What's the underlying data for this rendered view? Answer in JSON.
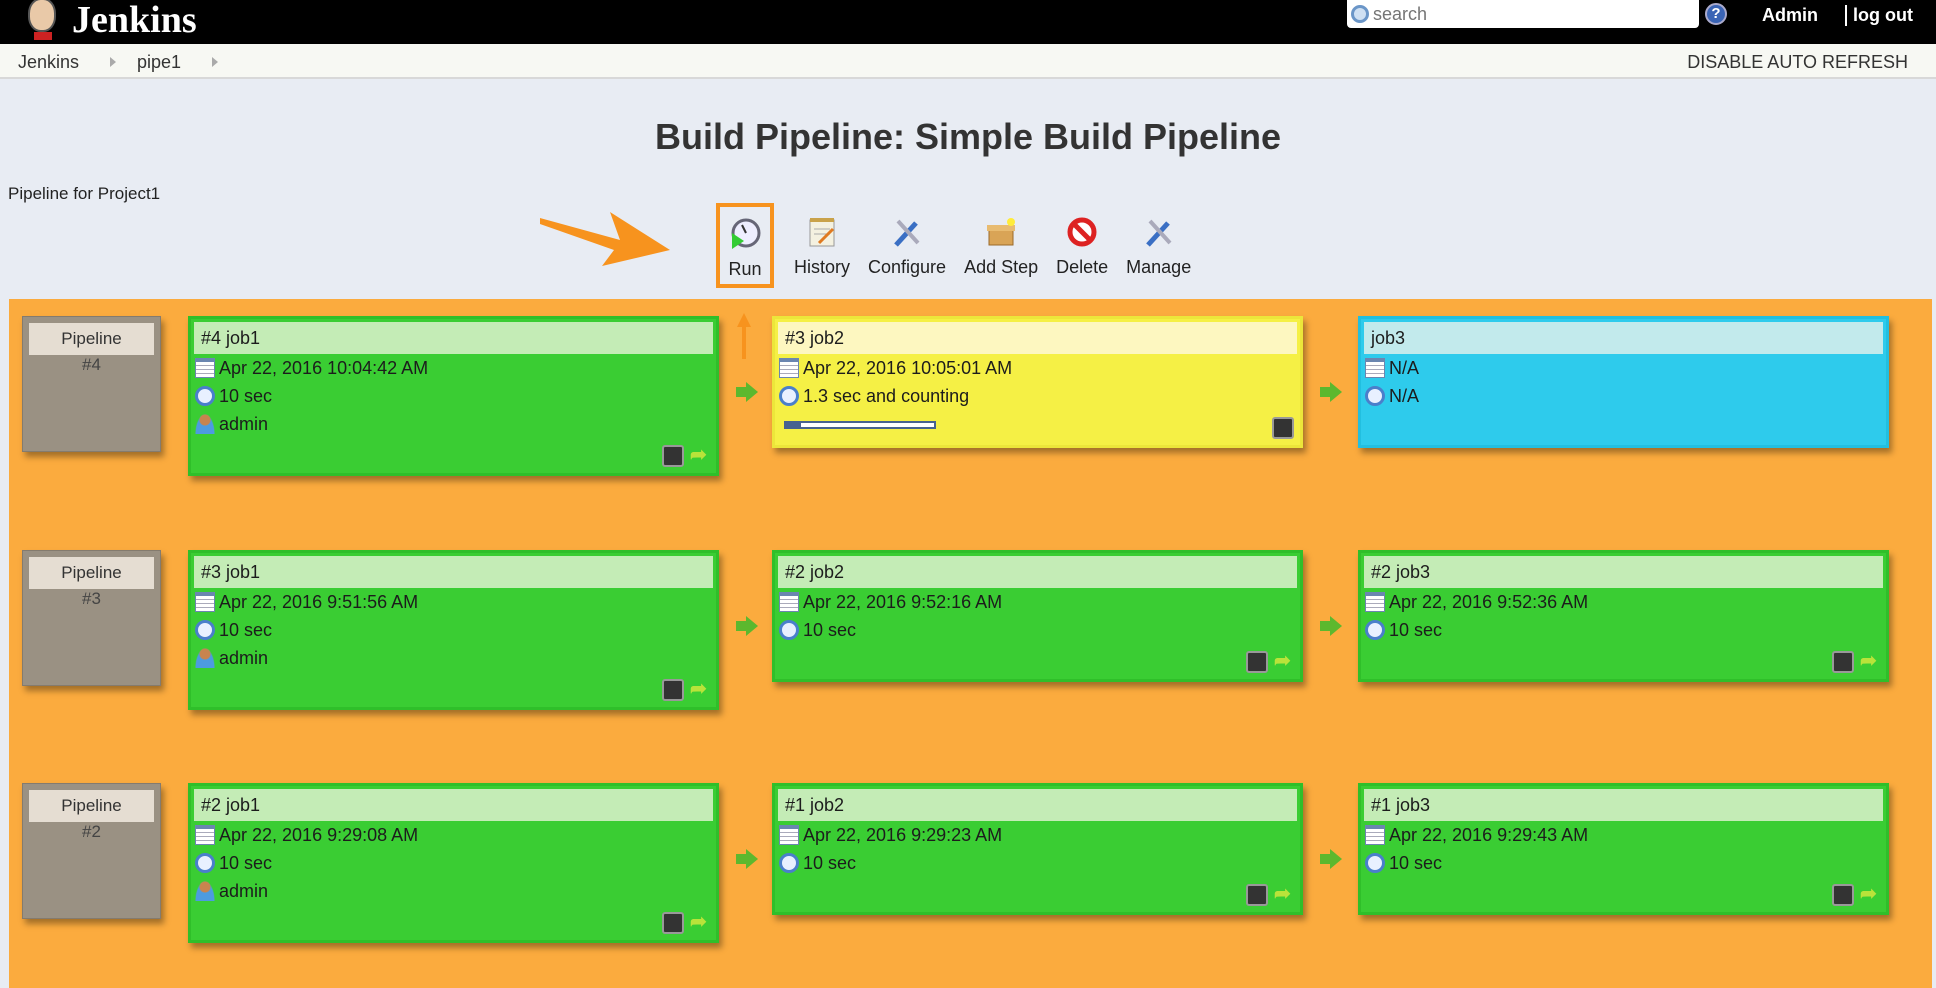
{
  "header": {
    "brand": "Jenkins",
    "search_placeholder": "search",
    "help_icon": "help-icon",
    "user": "Admin",
    "logout": "log out"
  },
  "breadcrumb": [
    "Jenkins",
    "pipe1"
  ],
  "auto_refresh": "DISABLE AUTO REFRESH",
  "page_title": "Build Pipeline: Simple Build Pipeline",
  "subtitle": "Pipeline for Project1",
  "toolbar": [
    {
      "label": "Run",
      "icon": "run-clock-icon",
      "highlighted": true
    },
    {
      "label": "History",
      "icon": "notepad-icon"
    },
    {
      "label": "Configure",
      "icon": "tools-icon"
    },
    {
      "label": "Add Step",
      "icon": "package-icon"
    },
    {
      "label": "Delete",
      "icon": "no-entry-icon"
    },
    {
      "label": "Manage",
      "icon": "tools-icon"
    }
  ],
  "colors": {
    "success": "#3acd33",
    "running": "#f5f045",
    "pending": "#2ecbec",
    "board": "#fbab3e",
    "highlight": "#f7931e"
  },
  "pipelines": [
    {
      "label": "Pipeline",
      "number": "#4",
      "jobs": [
        {
          "title": "#4 job1",
          "status": "success",
          "date": "Apr 22, 2016 10:04:42 AM",
          "duration": "10 sec",
          "user": "admin"
        },
        {
          "title": "#3 job2",
          "status": "running",
          "date": "Apr 22, 2016 10:05:01 AM",
          "duration": "1.3 sec and counting",
          "progress": 10
        },
        {
          "title": "job3",
          "status": "pending",
          "date": "N/A",
          "duration": "N/A"
        }
      ]
    },
    {
      "label": "Pipeline",
      "number": "#3",
      "jobs": [
        {
          "title": "#3 job1",
          "status": "success",
          "date": "Apr 22, 2016 9:51:56 AM",
          "duration": "10 sec",
          "user": "admin"
        },
        {
          "title": "#2 job2",
          "status": "success",
          "date": "Apr 22, 2016 9:52:16 AM",
          "duration": "10 sec"
        },
        {
          "title": "#2 job3",
          "status": "success",
          "date": "Apr 22, 2016 9:52:36 AM",
          "duration": "10 sec"
        }
      ]
    },
    {
      "label": "Pipeline",
      "number": "#2",
      "jobs": [
        {
          "title": "#2 job1",
          "status": "success",
          "date": "Apr 22, 2016 9:29:08 AM",
          "duration": "10 sec",
          "user": "admin"
        },
        {
          "title": "#1 job2",
          "status": "success",
          "date": "Apr 22, 2016 9:29:23 AM",
          "duration": "10 sec"
        },
        {
          "title": "#1 job3",
          "status": "success",
          "date": "Apr 22, 2016 9:29:43 AM",
          "duration": "10 sec"
        }
      ]
    }
  ]
}
